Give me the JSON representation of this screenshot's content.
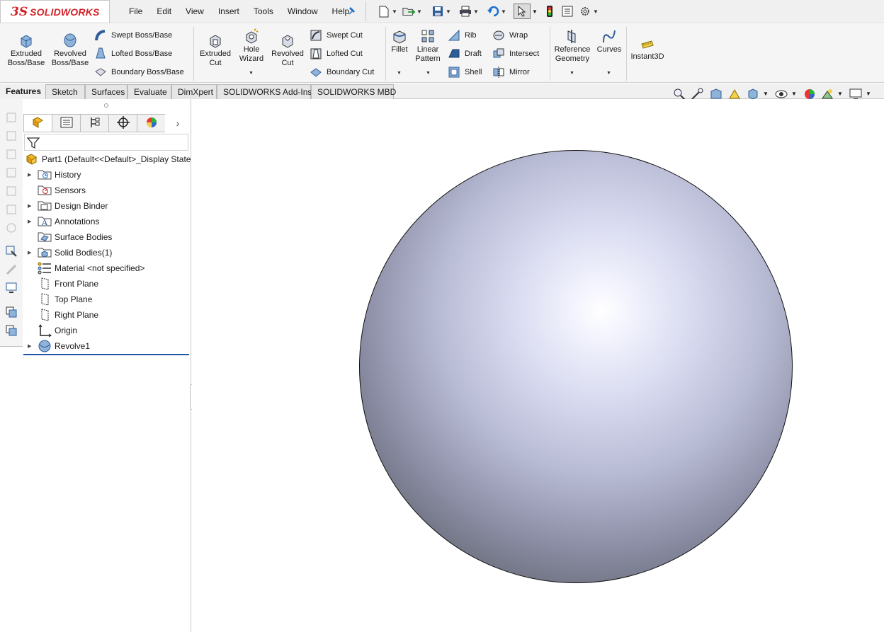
{
  "app": {
    "logo_ds": "3S",
    "logo_text": "SOLIDWORKS"
  },
  "menu": [
    "File",
    "Edit",
    "View",
    "Insert",
    "Tools",
    "Window",
    "Help"
  ],
  "quick_access_icons": [
    "new-document-icon",
    "open-icon",
    "save-icon",
    "print-icon",
    "undo-icon",
    "select-icon",
    "rebuild-icon",
    "file-properties-icon",
    "options-icon"
  ],
  "toolbar": {
    "extruded_boss": "Extruded\nBoss/Base",
    "revolved_boss": "Revolved\nBoss/Base",
    "swept_boss": "Swept Boss/Base",
    "lofted_boss": "Lofted Boss/Base",
    "boundary_boss": "Boundary Boss/Base",
    "extruded_cut": "Extruded\nCut",
    "hole_wizard": "Hole\nWizard",
    "revolved_cut": "Revolved\nCut",
    "swept_cut": "Swept Cut",
    "lofted_cut": "Lofted Cut",
    "boundary_cut": "Boundary Cut",
    "fillet": "Fillet",
    "linear_pattern": "Linear\nPattern",
    "rib": "Rib",
    "draft": "Draft",
    "shell": "Shell",
    "wrap": "Wrap",
    "intersect": "Intersect",
    "mirror": "Mirror",
    "reference_geometry": "Reference\nGeometry",
    "curves": "Curves",
    "instant3d": "Instant3D"
  },
  "tabs": [
    "Features",
    "Sketch",
    "Surfaces",
    "Evaluate",
    "DimXpert",
    "SOLIDWORKS Add-Ins",
    "SOLIDWORKS MBD"
  ],
  "active_tab": "Features",
  "tree": {
    "root": "Part1  (Default<<Default>_Display State",
    "items": [
      {
        "label": "History",
        "icon": "history-folder-icon",
        "expandable": true
      },
      {
        "label": "Sensors",
        "icon": "sensors-folder-icon",
        "expandable": false
      },
      {
        "label": "Design Binder",
        "icon": "design-binder-icon",
        "expandable": true
      },
      {
        "label": "Annotations",
        "icon": "annotations-icon",
        "expandable": true
      },
      {
        "label": "Surface Bodies",
        "icon": "surface-bodies-icon",
        "expandable": false
      },
      {
        "label": "Solid Bodies(1)",
        "icon": "solid-bodies-icon",
        "expandable": true
      },
      {
        "label": "Material <not specified>",
        "icon": "material-icon",
        "expandable": false
      },
      {
        "label": "Front Plane",
        "icon": "plane-icon",
        "expandable": false
      },
      {
        "label": "Top Plane",
        "icon": "plane-icon",
        "expandable": false
      },
      {
        "label": "Right Plane",
        "icon": "plane-icon",
        "expandable": false
      },
      {
        "label": "Origin",
        "icon": "origin-icon",
        "expandable": false
      },
      {
        "label": "Revolve1",
        "icon": "revolve-icon",
        "expandable": true
      }
    ]
  },
  "colors": {
    "accent": "#d2232a",
    "rollback_bar": "#1e5aa8",
    "link_blue": "#1d6fd1"
  }
}
